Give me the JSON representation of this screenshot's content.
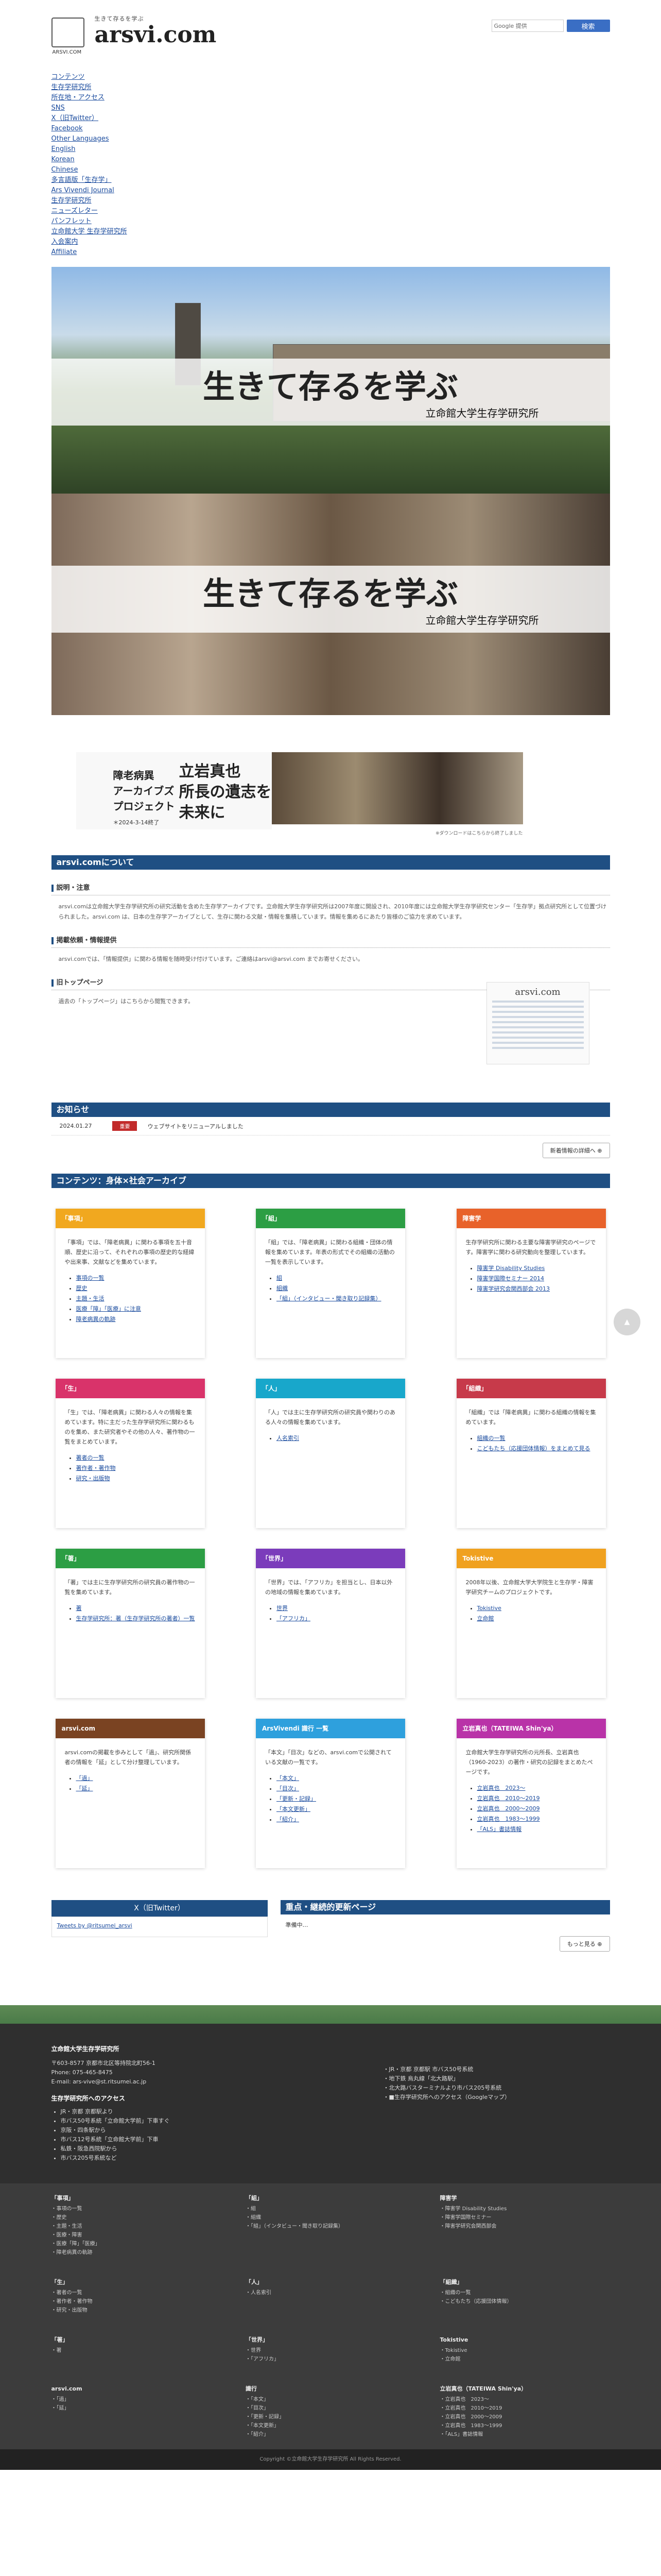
{
  "header": {
    "tagline": "生きて存るを学ぶ",
    "site_name": "arsvi.com",
    "sub": "ARSVI.COM",
    "search_brand": "Google 提供",
    "search_button": "検索"
  },
  "nav": [
    "コンテンツ",
    "生存学研究所",
    "所在地・アクセス",
    "SNS",
    "X（旧Twitter）",
    "Facebook",
    "Other Languages",
    "English",
    "Korean",
    "Chinese",
    "多言語版「生存学」",
    "Ars Vivendi Journal",
    "生存学研究所",
    "ニューズレター",
    "パンフレット",
    "立命館大学 生存学研究所",
    "入会案内",
    "Affiliate"
  ],
  "hero": {
    "title": "生きて存るを学ぶ",
    "institute": "立命館大学生存学研究所"
  },
  "banner": {
    "project": [
      "障老病異",
      "アーカイブズ",
      "プロジェクト"
    ],
    "title": [
      "立岩真也",
      "所長の遺志を",
      "未来に"
    ],
    "date": "＊2024-3-14終了",
    "credit": "※ダウンロードはこちらから終了しました"
  },
  "about": {
    "heading": "arsvi.comについて",
    "sections": [
      {
        "title": "説明・注意",
        "text": "arsvi.comは立命館大学生存学研究所の研究活動を含めた生存学アーカイブです。立命館大学生存学研究所は2007年度に開設され、2010年度には立命館大学生存学研究センター「生存学」拠点研究所として位置づけられました。arsvi.com は、日本の生存学アーカイブとして、生存に関わる文献・情報を集積しています。情報を集めるにあたり皆様のご協力を求めています。"
      },
      {
        "title": "掲載依頼・情報提供",
        "text": "arsvi.comでは、「情報提供」に関わる情報を随時受け付けています。ご連絡はarsvi@arsvi.com までお寄せください。"
      },
      {
        "title": "旧トップページ",
        "text": "過去の「トップページ」はこちらから閲覧できます。"
      }
    ],
    "thumb_title": "arsvi.com"
  },
  "news": {
    "heading": "お知らせ",
    "items": [
      {
        "date": "2024.01.27",
        "badge": "重要",
        "text": "ウェブサイトをリニューアルしました"
      }
    ],
    "more": "新着情報の詳細へ"
  },
  "contents": {
    "heading": "コンテンツ：身体×社会アーカイブ",
    "cards": [
      {
        "title": "「事項」",
        "color": "#f1a81f",
        "desc": "「事項」では、「障老病異」に関わる事項を五十音順、歴史に沿って、それぞれの事項の歴史的な経緯や出来事、文献などを集めています。",
        "links": [
          "事項の一覧",
          "歴史",
          "主題・生活",
          "医療「障」「医療」に注意",
          "障老病異の軌跡"
        ]
      },
      {
        "title": "「組」",
        "color": "#2c9e44",
        "desc": "「組」では、「障老病異」に関わる組織・団体の情報を集めています。年表の形式でその組織の活動の一覧を表示しています。",
        "links": [
          "組",
          "組織",
          "「組」（インタビュー・聞き取り記録集）"
        ]
      },
      {
        "title": "障害学",
        "color": "#e8622a",
        "desc": "生存学研究所に関わる主要な障害学研究のページです。障害学に関わる研究動向を整理しています。",
        "links": [
          "障害学 Disability Studies",
          "障害学国際セミナー 2014",
          "障害学研究会関西部会 2013"
        ]
      },
      {
        "title": "「生」",
        "color": "#d9336a",
        "desc": "「生」では、「障老病異」に関わる人々の情報を集めています。特に主だった生存学研究所に関わるものを集め、また研究者やその他の人々、著作物の一覧をまとめています。",
        "links": [
          "著者の一覧",
          "著作者・著作物",
          "研究・出版物"
        ]
      },
      {
        "title": "「人」",
        "color": "#18a7cb",
        "desc": "「人」では主に生存学研究所の研究員や関わりのある人々の情報を集めています。",
        "links": [
          "人名索引"
        ]
      },
      {
        "title": "「組織」",
        "color": "#c73a4a",
        "desc": "「組織」では「障老病異」に関わる組織の情報を集めています。",
        "links": [
          "組織の一覧",
          "こどもたち（応援団体情報）をまとめて見る"
        ]
      },
      {
        "title": "「著」",
        "color": "#2c9e44",
        "desc": "「著」では主に生存学研究所の研究員の著作物の一覧を集めています。",
        "links": [
          "著",
          "生存学研究所：著（生存学研究所の著者）一覧"
        ]
      },
      {
        "title": "「世界」",
        "color": "#7b3cbb",
        "desc": "「世界」では、「アフリカ」を担当とし、日本以外の地域の情報を集めています。",
        "links": [
          "世界",
          "「アフリカ」"
        ]
      },
      {
        "title": "Tokistive",
        "color": "#f0a11f",
        "desc": "2008年以後、立命館大学大学院生と生存学・障害学研究チームのプロジェクトです。",
        "links": [
          "Tokistive",
          "立命館"
        ]
      },
      {
        "title": "arsvi.com",
        "color": "#7a4322",
        "desc": "arsvi.comの掲載を歩みとして「過」、研究所関係者の情報を「延」として分け整理しています。",
        "links": [
          "「過」",
          "「延」"
        ]
      },
      {
        "title": "ArsVivendi 識行 一覧",
        "color": "#2ea0dd",
        "desc": "「本文」「目次」などの、arsvi.comで公開されている文献の一覧です。",
        "links": [
          "「本文」",
          "「目次」",
          "「更新・記録」",
          "「本文更新」",
          "「紹介」"
        ]
      },
      {
        "title": "立岩真也（TATEIWA Shin'ya）",
        "color": "#b933a8",
        "desc": "立命館大学生存学研究所の元所長、立岩真也（1960-2023）の著作・研究の記録をまとめたページです。",
        "links": [
          "立岩真也　2023～",
          "立岩真也　2010～2019",
          "立岩真也　2000～2009",
          "立岩真也　1983～1999",
          "「ALS」書誌情報"
        ]
      }
    ]
  },
  "twitter": {
    "heading": "X（旧Twitter）",
    "text": "Tweets by @ritsumei_arsvi"
  },
  "updates": {
    "heading": "重点・継続的更新ページ",
    "text": "準備中…",
    "more": "もっと見る"
  },
  "footer": {
    "org": "立命館大学生存学研究所",
    "address": [
      "〒603-8577 京都市北区等持院北町56-1",
      "Phone: 075-465-8475",
      "E-mail: ars-vive@st.ritsumei.ac.jp"
    ],
    "access_title": "生存学研究所へのアクセス",
    "access": [
      "JR・京都 京都駅より",
      "市バス50号系統「立命館大学前」下車すぐ",
      "京阪・四条駅から",
      "市バス12号系統「立命館大学前」下車",
      "私鉄・阪急西院駅から",
      "市バス205号系統など"
    ],
    "right": [
      "JR・京都 京都駅 市バス50号系統",
      "地下鉄 烏丸線「北大路駅」",
      "北大路バスターミナルより市バス205号系統",
      "■生存学研究所へのアクセス（Googleマップ）"
    ],
    "sections": [
      {
        "title": "「事項」",
        "items": [
          "事項の一覧",
          "歴史",
          "主題・生活",
          "医療・障害",
          "医療「障」「医療」",
          "障老病異の軌跡"
        ]
      },
      {
        "title": "「組」",
        "items": [
          "組",
          "組織",
          "「組」（インタビュー・聞き取り記録集）"
        ]
      },
      {
        "title": "障害学",
        "items": [
          "障害学 Disability Studies",
          "障害学国際セミナー",
          "障害学研究会関西部会"
        ]
      },
      {
        "title": "「生」",
        "items": [
          "著者の一覧",
          "著作者・著作物",
          "研究・出版物"
        ]
      },
      {
        "title": "「人」",
        "items": [
          "人名索引"
        ]
      },
      {
        "title": "「組織」",
        "items": [
          "組織の一覧",
          "こどもたち（応援団体情報）"
        ]
      },
      {
        "title": "「著」",
        "items": [
          "著"
        ]
      },
      {
        "title": "「世界」",
        "items": [
          "世界",
          "「アフリカ」"
        ]
      },
      {
        "title": "Tokistive",
        "items": [
          "Tokistive",
          "立命館"
        ]
      },
      {
        "title": "arsvi.com",
        "items": [
          "「過」",
          "「延」"
        ]
      },
      {
        "title": "識行",
        "items": [
          "「本文」",
          "「目次」",
          "「更新・記録」",
          "「本文更新」",
          "「紹介」"
        ]
      },
      {
        "title": "立岩真也（TATEIWA Shin'ya）",
        "items": [
          "立岩真也　2023～",
          "立岩真也　2010～2019",
          "立岩真也　2000～2009",
          "立岩真也　1983～1999",
          "「ALS」書誌情報"
        ]
      }
    ],
    "copyright": "Copyright ©立命館大学生存学研究所 All Rights Reserved."
  }
}
